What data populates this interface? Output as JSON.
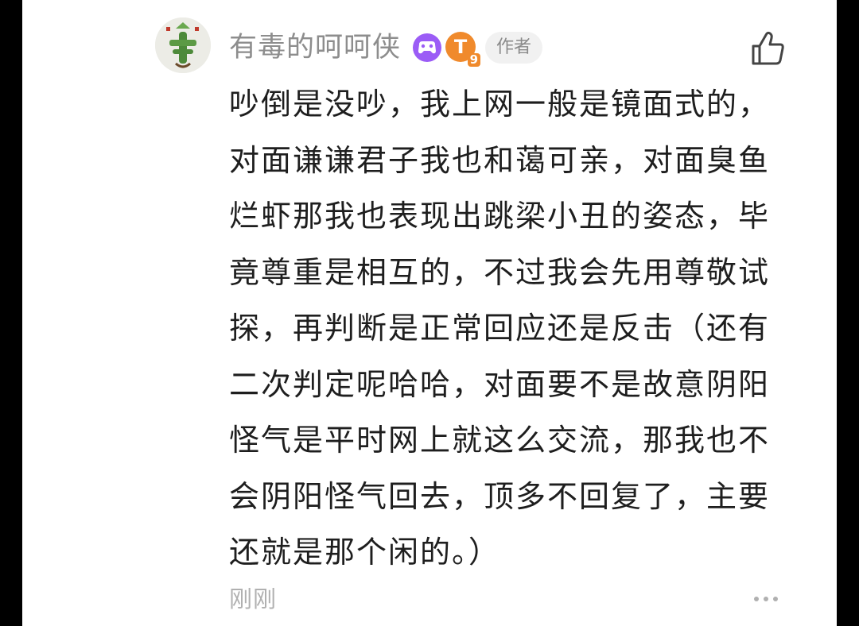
{
  "comment": {
    "username": "有毒的呵呵侠",
    "level_badge_letter": "T",
    "level_badge_number": "9",
    "author_tag": "作者",
    "body": "吵倒是没吵，我上网一般是镜面式的，\n对面谦谦君子我也和蔼可亲，对面臭鱼\n烂虾那我也表现出跳梁小丑的姿态，毕\n竟尊重是相互的，不过我会先用尊敬试\n探，再判断是正常回应还是反击（还有\n二次判定呢哈哈，对面要不是故意阴阳\n怪气是平时网上就这么交流，那我也不\n会阴阳怪气回去，顶多不回复了，主要\n还就是那个闲的。）",
    "timestamp": "刚刚"
  },
  "icons": {
    "avatar": "cactus-avatar",
    "game_badge": "game-controller-icon",
    "level_badge": "level-badge",
    "like": "thumbs-up-icon",
    "more": "more-dots-icon"
  },
  "colors": {
    "username": "#8d8d8d",
    "body_text": "#1e1e1e",
    "timestamp": "#b0b0b0",
    "game_badge": "#9b5cf6",
    "level_badge": "#f08a2c",
    "author_tag_bg": "#f1f1f1"
  }
}
